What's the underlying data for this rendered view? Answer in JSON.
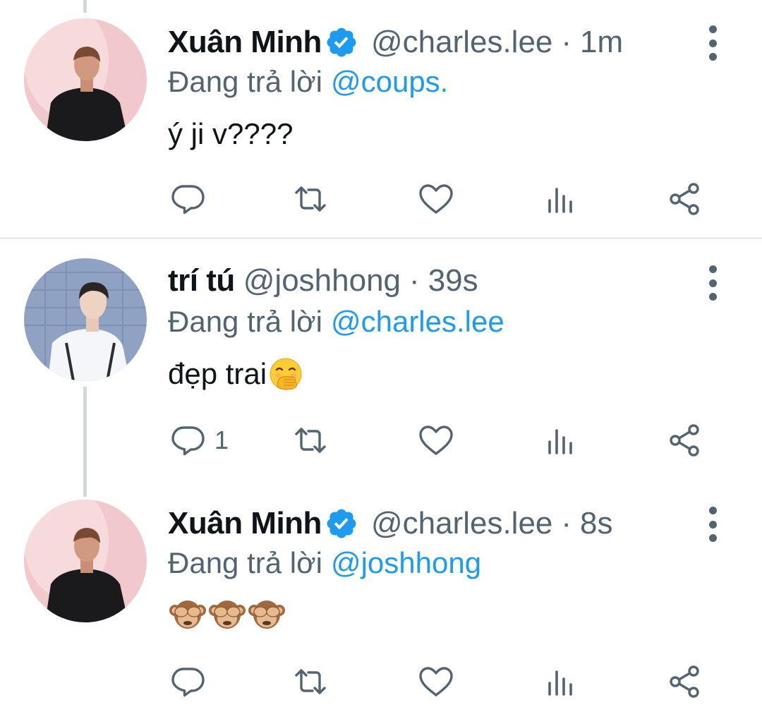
{
  "colors": {
    "accent": "#1d9bf0",
    "muted": "#536471",
    "text": "#0f1419",
    "divider": "#e6ecf0",
    "thread": "#cfd9de"
  },
  "tweets": [
    {
      "name": "Xuân Minh",
      "verified": true,
      "handle": "@charles.lee",
      "dot": "·",
      "time": "1m",
      "reply_prefix": "Đang trả lời",
      "reply_mention": "@coups.",
      "text": "ý ji v????",
      "avatar": "avatar-dark-outfit",
      "reply_count": ""
    },
    {
      "name": "trí tú",
      "verified": false,
      "handle": "@joshhong",
      "dot": "·",
      "time": "39s",
      "reply_prefix": "Đang trả lời",
      "reply_mention": "@charles.lee",
      "text": "đẹp trai",
      "text_emoji": "face-with-hand-over-mouth",
      "avatar": "avatar-white-jacket",
      "reply_count": "1"
    },
    {
      "name": "Xuân Minh",
      "verified": true,
      "handle": "@charles.lee",
      "dot": "·",
      "time": "8s",
      "reply_prefix": "Đang trả lời",
      "reply_mention": "@joshhong",
      "text": "",
      "text_emoji": "see-no-evil-monkey x3",
      "avatar": "avatar-dark-outfit",
      "reply_count": ""
    }
  ],
  "actions": [
    "reply-icon",
    "retweet-icon",
    "like-icon",
    "analytics-icon",
    "share-icon"
  ]
}
